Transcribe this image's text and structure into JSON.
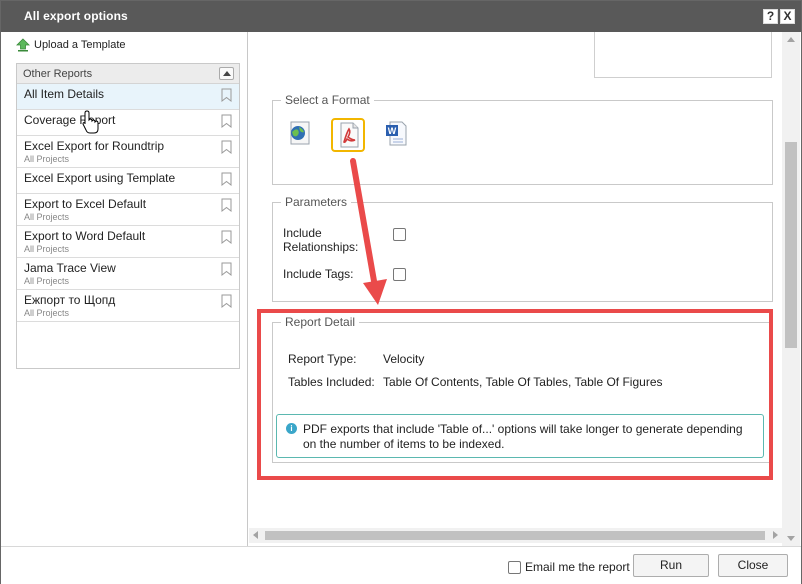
{
  "dialog": {
    "title": "All export options",
    "help_label": "?",
    "close_label": "X"
  },
  "sidebar": {
    "upload_label": "Upload a Template",
    "reports_header": "Other Reports",
    "items": [
      {
        "name": "All Item Details",
        "sub": "",
        "selected": true
      },
      {
        "name": "Coverage Report",
        "sub": ""
      },
      {
        "name": "Excel Export for Roundtrip",
        "sub": "All Projects"
      },
      {
        "name": "Excel Export using Template",
        "sub": ""
      },
      {
        "name": "Export to Excel Default",
        "sub": "All Projects"
      },
      {
        "name": "Export to Word Default",
        "sub": "All Projects"
      },
      {
        "name": "Jama Trace View",
        "sub": "All Projects"
      },
      {
        "name": "Ежпорт то Щопд",
        "sub": "All Projects"
      }
    ]
  },
  "main": {
    "format": {
      "legend": "Select a Format",
      "options": [
        {
          "icon": "html-globe-icon",
          "selected": false
        },
        {
          "icon": "pdf-icon",
          "selected": true
        },
        {
          "icon": "word-icon",
          "selected": false
        }
      ],
      "highlight_color": "#f2b600"
    },
    "parameters": {
      "legend": "Parameters",
      "include_relationships_label": "Include Relationships:",
      "include_tags_label": "Include Tags:",
      "include_relationships_checked": false,
      "include_tags_checked": false
    },
    "report_detail": {
      "legend": "Report Detail",
      "report_type_label": "Report Type:",
      "report_type_value": "Velocity",
      "tables_label": "Tables Included:",
      "tables_value": "Table Of Contents, Table Of Tables, Table Of Figures",
      "info_text": "PDF exports that include 'Table of...' options will take longer to generate depending on the number of items to be indexed."
    },
    "annotation_color": "#ea4a4a"
  },
  "footer": {
    "email_label": "Email me the report",
    "email_checked": false,
    "run_label": "Run",
    "close_label": "Close"
  }
}
